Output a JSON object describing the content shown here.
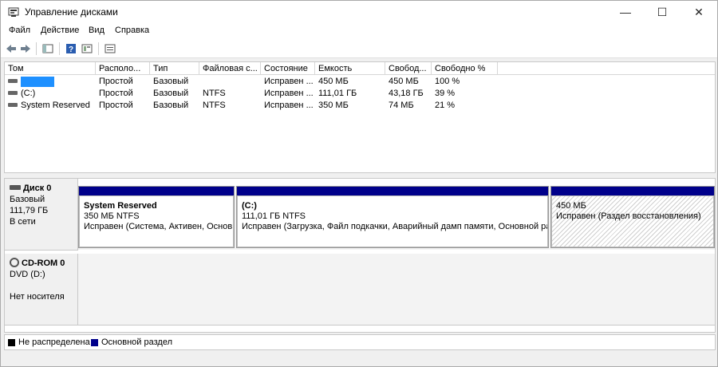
{
  "window": {
    "title": "Управление дисками",
    "minimize_glyph": "—",
    "maximize_glyph": "☐",
    "close_glyph": "✕"
  },
  "menu": [
    "Файл",
    "Действие",
    "Вид",
    "Справка"
  ],
  "toolbar": {
    "icons": [
      "back-arrow-icon",
      "forward-arrow-icon",
      "console-tree-icon",
      "help-icon",
      "properties-icon",
      "list-view-icon"
    ]
  },
  "volume_table": {
    "columns": [
      "Том",
      "Располо...",
      "Тип",
      "Файловая с...",
      "Состояние",
      "Емкость",
      "Свобод...",
      "Свободно %"
    ],
    "rows": [
      {
        "name": "",
        "layout": "Простой",
        "type": "Базовый",
        "fs": "",
        "status": "Исправен ...",
        "capacity": "450 МБ",
        "free": "450 МБ",
        "free_pct": "100 %"
      },
      {
        "name": "(C:)",
        "layout": "Простой",
        "type": "Базовый",
        "fs": "NTFS",
        "status": "Исправен ...",
        "capacity": "111,01 ГБ",
        "free": "43,18 ГБ",
        "free_pct": "39 %"
      },
      {
        "name": "System Reserved",
        "layout": "Простой",
        "type": "Базовый",
        "fs": "NTFS",
        "status": "Исправен ...",
        "capacity": "350 МБ",
        "free": "74 МБ",
        "free_pct": "21 %"
      }
    ]
  },
  "disks": [
    {
      "title": "Диск 0",
      "line1": "Базовый",
      "line2": "111,79 ГБ",
      "line3": "В сети",
      "partitions": [
        {
          "name": "System Reserved",
          "size": "350 МБ NTFS",
          "status": "Исправен (Система, Активен, Основн"
        },
        {
          "name": "(C:)",
          "size": "111,01 ГБ NTFS",
          "status": "Исправен (Загрузка, Файл подкачки, Аварийный дамп памяти, Основной ра"
        },
        {
          "name": "",
          "size": "450 МБ",
          "status": "Исправен (Раздел восстановления)"
        }
      ]
    },
    {
      "title": "CD-ROM 0",
      "line1": "DVD (D:)",
      "line2": "",
      "line3": "Нет носителя"
    }
  ],
  "legend": [
    {
      "label": "Не распределена",
      "color": "#000000"
    },
    {
      "label": "Основной раздел",
      "color": "#00008b"
    }
  ],
  "colors": {
    "primary_partition": "#00008b",
    "unallocated": "#000000",
    "selection_highlight": "#1e90ff"
  }
}
